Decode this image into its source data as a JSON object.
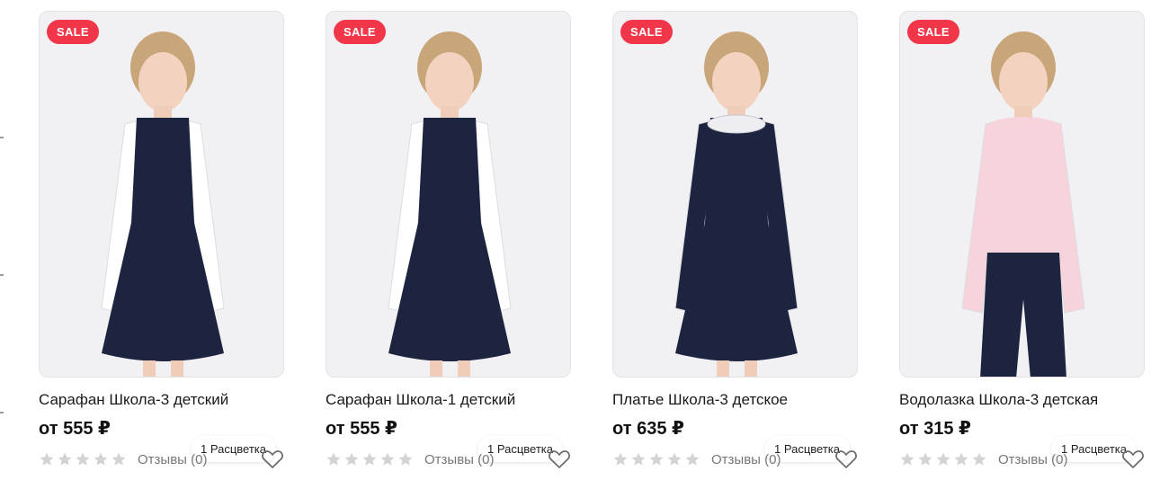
{
  "products": [
    {
      "badge": "SALE",
      "variants": "1 Расцветка",
      "title": "Сарафан Школа-3 детский",
      "price": "от 555 ₽",
      "reviews": "Отзывы (0)",
      "rating": 0,
      "top_color": "#ffffff",
      "dress_color": "#1c2440"
    },
    {
      "badge": "SALE",
      "variants": "1 Расцветка",
      "title": "Сарафан Школа-1 детский",
      "price": "от 555 ₽",
      "reviews": "Отзывы (0)",
      "rating": 0,
      "top_color": "#ffffff",
      "dress_color": "#1c2440"
    },
    {
      "badge": "SALE",
      "variants": "1 Расцветка",
      "title": "Платье Школа-3 детское",
      "price": "от 635 ₽",
      "reviews": "Отзывы (0)",
      "rating": 0,
      "top_color": "#1c2440",
      "dress_color": "#1c2440"
    },
    {
      "badge": "SALE",
      "variants": "1 Расцветка",
      "title": "Водолазка Школа-3 детская",
      "price": "от 315 ₽",
      "reviews": "Отзывы (0)",
      "rating": 0,
      "top_color": "#f7d3db",
      "dress_color": "#1c2440"
    }
  ],
  "colors": {
    "sale_badge": "#f2364a",
    "star_empty": "#d3d3d3",
    "photo_bg": "#f1f1f3"
  },
  "icons": {
    "star": "star-icon",
    "favorite": "heart-outline-icon"
  }
}
